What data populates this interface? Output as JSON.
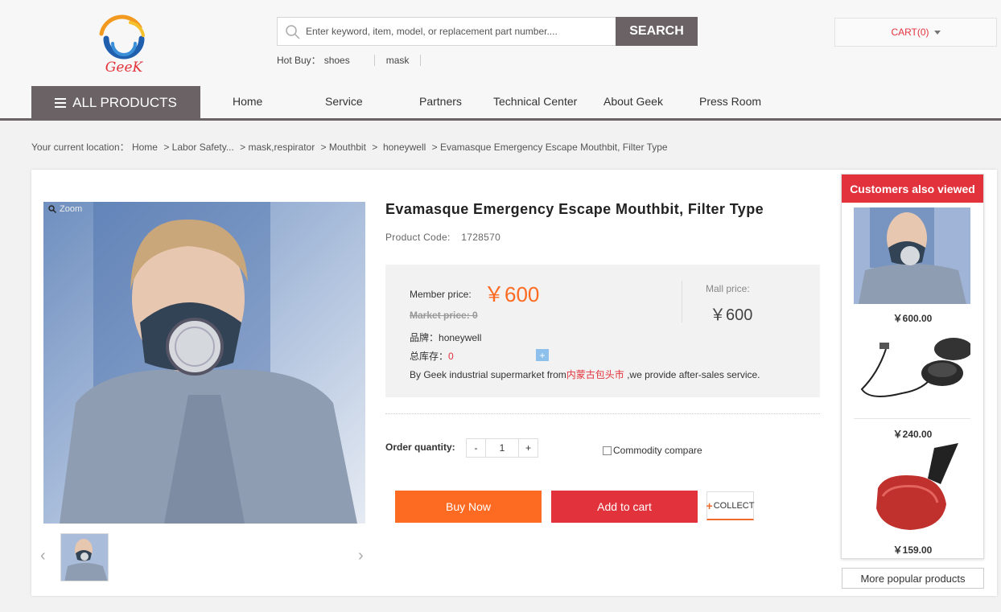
{
  "header": {
    "logo_text": "GeeK",
    "search": {
      "placeholder": "Enter keyword, item, model, or replacement part number....",
      "button_label": "SEARCH"
    },
    "hot_buy": {
      "label": "Hot Buy：",
      "items": [
        "shoes",
        "mask"
      ]
    },
    "cart_label": "CART(0)"
  },
  "nav": {
    "all_products": "ALL PRODUCTS",
    "items": [
      "Home",
      "Service",
      "Partners",
      "Technical Center",
      "About Geek",
      "Press Room"
    ]
  },
  "breadcrumb": {
    "prefix": "Your current location：",
    "items": [
      "Home",
      "> Labor Safety...",
      "> mask,respirator",
      "> Mouthbit",
      ">  honeywell",
      "> Evamasque Emergency Escape Mouthbit, Filter Type"
    ]
  },
  "product": {
    "zoom_label": "Zoom",
    "title": "Evamasque Emergency Escape Mouthbit, Filter Type",
    "code_label": "Product Code:",
    "code": "1728570",
    "member_price_label": "Member price:",
    "member_price": "￥600",
    "market_price": "Market price:  0",
    "mall_price_label": "Mall price:",
    "mall_price": "￥600",
    "brand_label": "品牌：",
    "brand": "honeywell",
    "stock_label": "总库存：",
    "stock": "0",
    "service_prefix": "By Geek industrial supermarket from",
    "service_place": "内蒙古包头市",
    "service_suffix": " ,we provide after-sales service.",
    "qty_label": "Order quantity:",
    "qty_minus": "-",
    "qty_value": "1",
    "qty_plus": "+",
    "compare_label": "Commodity compare",
    "buy_now": "Buy Now",
    "add_to_cart": "Add to cart",
    "collect": "COLLECT"
  },
  "sidebar": {
    "title": "Customers also viewed",
    "items": [
      {
        "price": "￥600.00"
      },
      {
        "price": "￥240.00"
      },
      {
        "price": "￥159.00"
      }
    ],
    "more_label": "More popular products"
  },
  "colors": {
    "accent_red": "#e2333c",
    "accent_orange": "#fd6a22",
    "nav_gray": "#6a6264"
  }
}
